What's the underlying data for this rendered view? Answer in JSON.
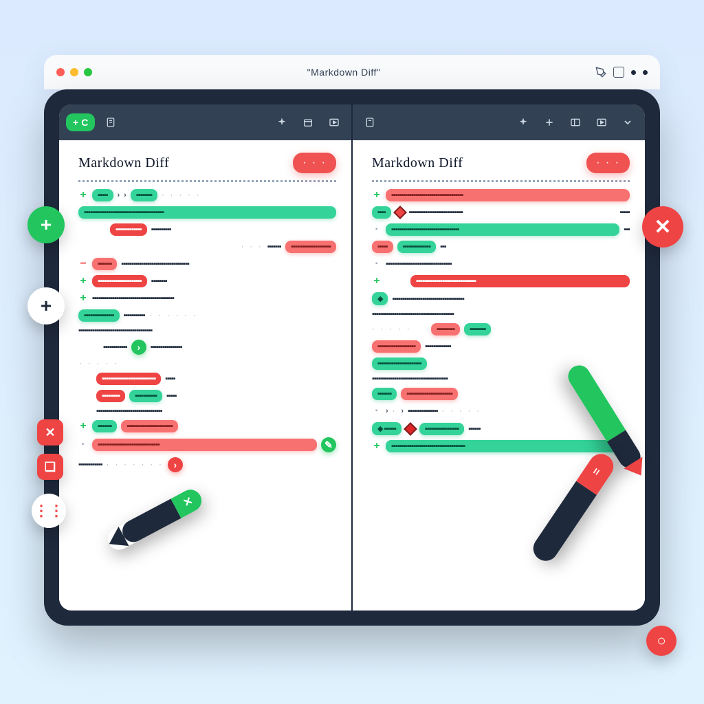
{
  "browser": {
    "title": "\"Markdown Diff\""
  },
  "toolbar": {
    "add_label": "C"
  },
  "panes": {
    "left": {
      "title": "Markdown Diff",
      "more": "· · ·"
    },
    "right": {
      "title": "Markdown Diff",
      "more": "· · ·"
    }
  },
  "floating": {
    "add_left": "+",
    "plus_white": "+",
    "close_right": "✕",
    "x_small": "✕",
    "dots": "⋮⋮"
  },
  "colors": {
    "add": "#22c55e",
    "remove": "#ef4444",
    "frame": "#1e293b"
  }
}
